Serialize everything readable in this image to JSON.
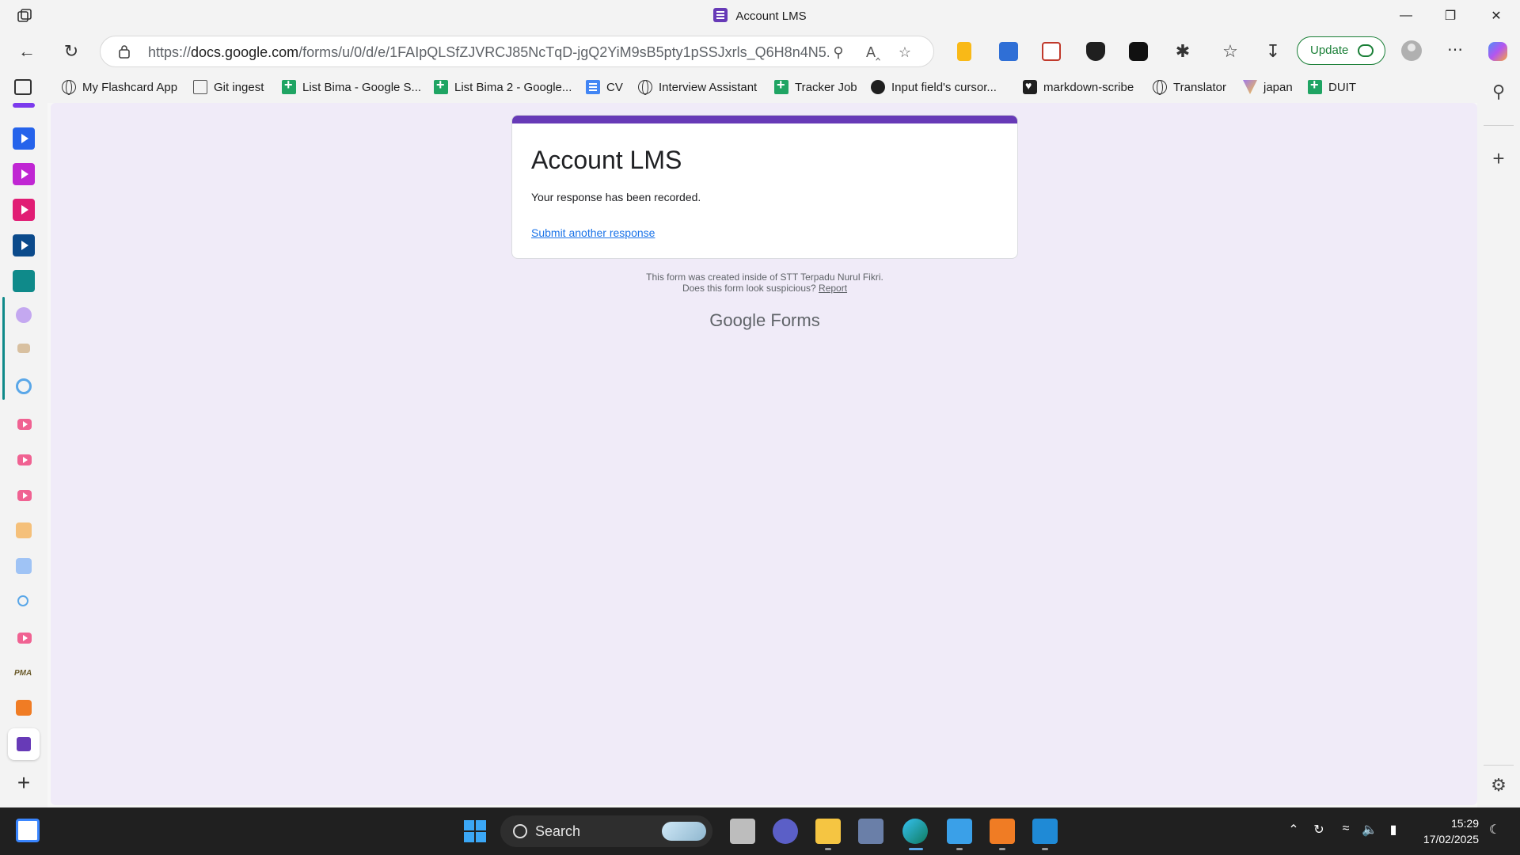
{
  "window": {
    "title": "Account LMS"
  },
  "address_bar": {
    "url_prefix": "https://",
    "url_host": "docs.google.com",
    "url_path": "/forms/u/0/d/e/1FAIpQLSfZJVRCJ85NcTqD-jgQ2YiM9sB5pty1pSSJxrls_Q6H8n4N5..."
  },
  "toolbar": {
    "update_label": "Update"
  },
  "bookmarks": [
    {
      "label": "My Flashcard App",
      "icon": "globe-icon"
    },
    {
      "label": "Git ingest",
      "icon": "page-icon"
    },
    {
      "label": "List Bima - Google S...",
      "icon": "sheets-icon"
    },
    {
      "label": "List Bima 2 - Google...",
      "icon": "sheets-icon"
    },
    {
      "label": "CV",
      "icon": "docs-icon"
    },
    {
      "label": "Interview Assistant",
      "icon": "globe-icon"
    },
    {
      "label": "Tracker Job",
      "icon": "sheets-icon"
    },
    {
      "label": "Input field's cursor...",
      "icon": "github-icon"
    },
    {
      "label": "markdown-scribe",
      "icon": "heart-icon"
    },
    {
      "label": "Translator",
      "icon": "globe-icon"
    },
    {
      "label": "japan",
      "icon": "vite-icon"
    },
    {
      "label": "DUIT",
      "icon": "sheets-icon"
    }
  ],
  "form": {
    "title": "Account LMS",
    "confirmation": "Your response has been recorded.",
    "submit_another": "Submit another response",
    "footer_line1": "This form was created inside of STT Terpadu Nurul Fikri.",
    "footer_line2": "Does this form look suspicious?",
    "report_link": "Report",
    "brand_google": "Google",
    "brand_forms": "Forms"
  },
  "taskbar": {
    "search_label": "Search"
  },
  "clock": {
    "time": "15:29",
    "date": "17/02/2025"
  },
  "colors": {
    "forms_purple": "#673ab7",
    "page_bg": "#f0ebf8",
    "link_blue": "#1a73e8"
  }
}
